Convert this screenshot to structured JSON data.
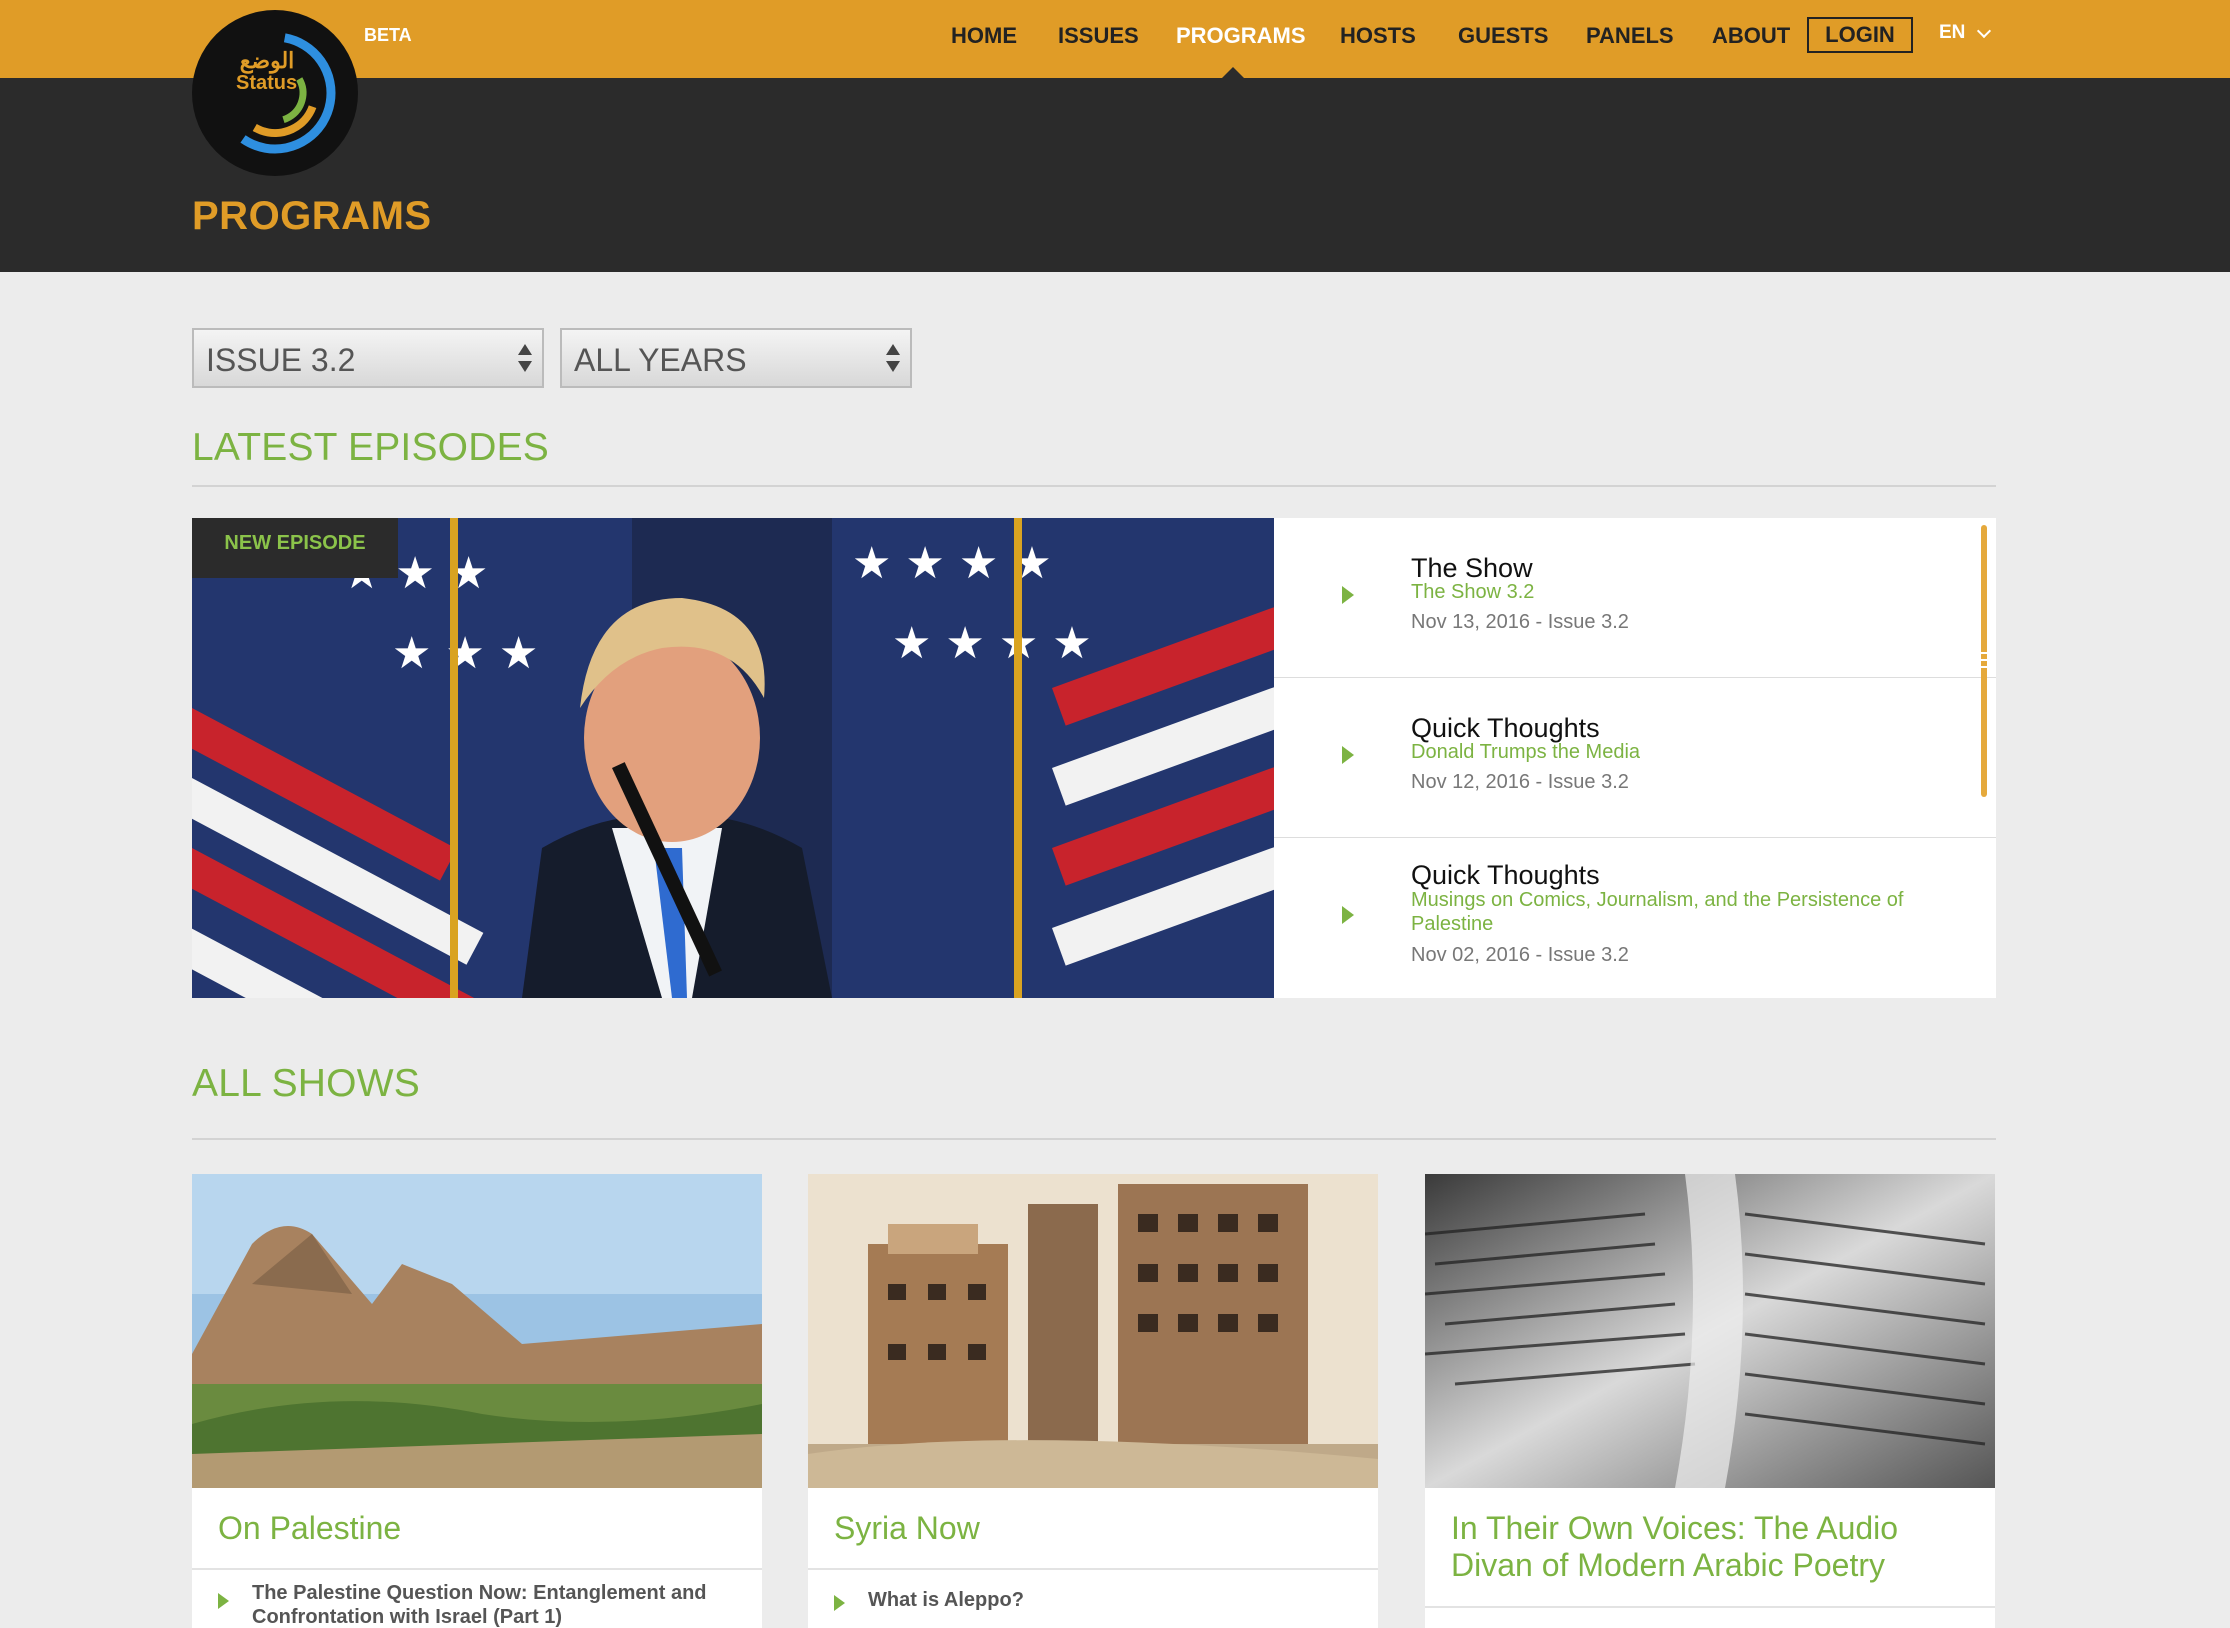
{
  "header": {
    "logo_arabic": "الوضع",
    "logo_text": "Status",
    "beta": "BETA",
    "nav": [
      {
        "label": "HOME"
      },
      {
        "label": "ISSUES"
      },
      {
        "label": "PROGRAMS",
        "active": true
      },
      {
        "label": "HOSTS"
      },
      {
        "label": "GUESTS"
      },
      {
        "label": "PANELS"
      },
      {
        "label": "ABOUT"
      }
    ],
    "login": "LOGIN",
    "language": "EN"
  },
  "page": {
    "title": "PROGRAMS"
  },
  "filters": {
    "issue": "ISSUE 3.2",
    "year": "ALL YEARS"
  },
  "latest": {
    "heading": "LATEST EPISODES",
    "badge": "NEW EPISODE",
    "episodes": [
      {
        "title": "The Show",
        "subtitle": "The Show 3.2",
        "date": "Nov 13, 2016 - Issue 3.2"
      },
      {
        "title": "Quick Thoughts",
        "subtitle": "Donald Trumps the Media",
        "date": "Nov 12, 2016 - Issue 3.2"
      },
      {
        "title": "Quick Thoughts",
        "subtitle": "Musings on Comics, Journalism, and the Persistence of Palestine",
        "date": "Nov 02, 2016 - Issue 3.2"
      }
    ]
  },
  "shows": {
    "heading": "ALL SHOWS",
    "items": [
      {
        "title": "On Palestine",
        "episode": "The Palestine Question Now: Entanglement and Confrontation with Israel (Part 1)"
      },
      {
        "title": "Syria Now",
        "episode": "What is Aleppo?"
      },
      {
        "title": "In Their Own Voices: The Audio Divan of Modern Arabic Poetry",
        "episode": ""
      }
    ]
  },
  "colors": {
    "accent_orange": "#e09c27",
    "accent_green": "#7cb342",
    "dark": "#2b2b2b"
  }
}
